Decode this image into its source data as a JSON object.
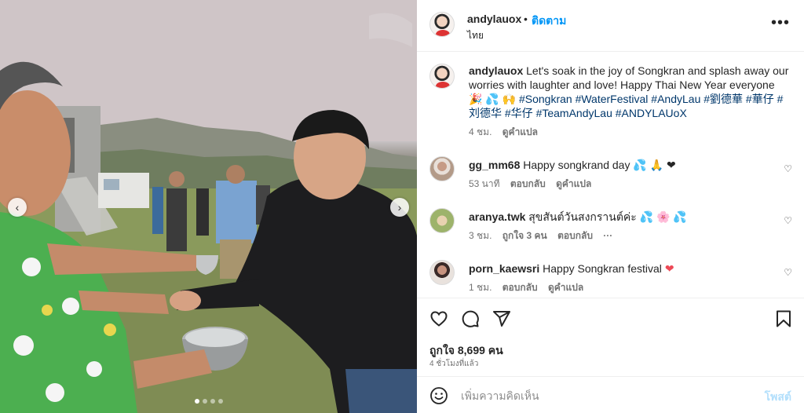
{
  "post": {
    "username": "andylauox",
    "follow_label": "ติดตาม",
    "location": "ไทย",
    "more_icon": "more-horizontal-icon",
    "caption": {
      "username": "andylauox",
      "text": "Let's soak in the joy of Songkran and splash away our worries with laughter and love! Happy Thai New Year everyone",
      "emojis": "🎉 💦 🙌",
      "hashtags": "#Songkran #WaterFestival #AndyLau #劉德華 #華仔 #刘德华 #华仔 #TeamAndyLau #ANDYLAUoX",
      "time": "4 ชม.",
      "translate": "ดูคำแปล"
    }
  },
  "comments": [
    {
      "username": "gg_mm68",
      "text": "Happy songkrand day",
      "emojis": "💦 🙏 ❤",
      "time": "53 นาที",
      "reply": "ตอบกลับ",
      "translate": "ดูคำแปล"
    },
    {
      "username": "aranya.twk",
      "text": "สุขสันต์วันสงกรานต์ค่ะ",
      "emojis": "💦 🌸 💦",
      "time": "3 ชม.",
      "likes": "ถูกใจ 3 คน",
      "reply": "ตอบกลับ",
      "more": "···"
    },
    {
      "username": "porn_kaewsri",
      "text": "Happy Songkran festival",
      "emojis": "❤",
      "time": "1 ชม.",
      "reply": "ตอบกลับ",
      "translate": "ดูคำแปล"
    }
  ],
  "actions": {
    "like_icon": "heart-icon",
    "comment_icon": "comment-icon",
    "share_icon": "share-icon",
    "save_icon": "bookmark-icon",
    "likes_text": "ถูกใจ 8,699 คน",
    "time_ago": "4 ชั่วโมงที่แล้ว"
  },
  "composer": {
    "placeholder": "เพิ่มความคิดเห็น",
    "post_label": "โพสต์"
  },
  "carousel": {
    "prev": "‹",
    "next": "›",
    "total": 4,
    "active": 0
  },
  "colors": {
    "link": "#0095f6",
    "hashtag": "#00376b",
    "heart_red": "#ed4956",
    "post_disabled": "#b2dffc"
  }
}
